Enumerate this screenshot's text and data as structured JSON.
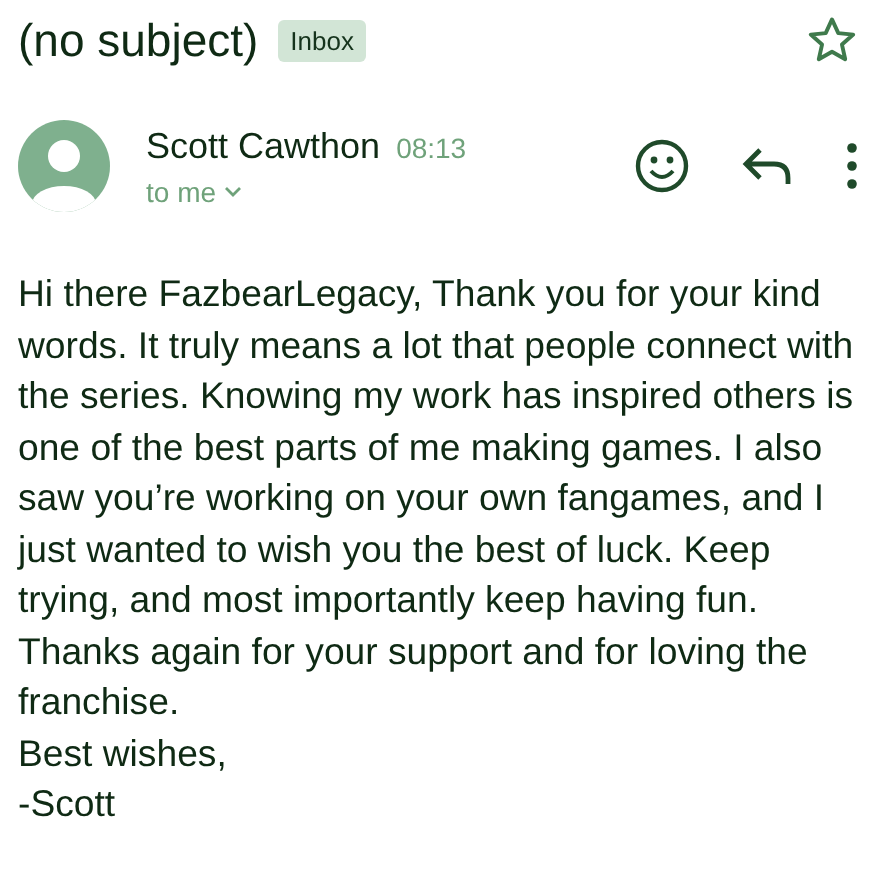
{
  "subject": "(no subject)",
  "label": "Inbox",
  "starred": false,
  "sender": {
    "name": "Scott Cawthon",
    "time": "08:13",
    "recipient": "to me"
  },
  "body": [
    "Hi there FazbearLegacy, Thank you for your kind words. It truly means a lot that people connect with the series. Knowing my work has inspired others is one of the best parts of me making games. I also saw you’re working on your own fangames, and I just wanted to wish you the best of luck. Keep trying, and most importantly keep having fun. Thanks again for your support and for loving the franchise.",
    "Best wishes,",
    "-Scott"
  ]
}
